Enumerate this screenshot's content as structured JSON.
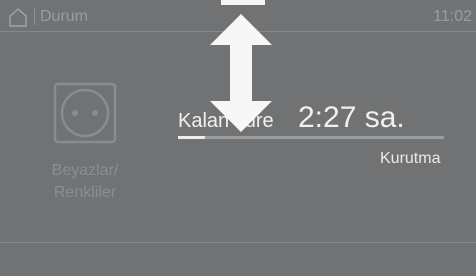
{
  "status_bar": {
    "title": "Durum",
    "time": "11:02"
  },
  "program": {
    "label": "Beyazlar/\nRenkliler",
    "icon": "socket-icon"
  },
  "remaining": {
    "label": "Kalan süre",
    "value": "2:27 sa.",
    "progress_fraction": 0.1
  },
  "phase": "Kurutma",
  "overlay": {
    "icon": "up-down-arrow-icon",
    "handle_icon": "drag-handle-icon"
  },
  "colors": {
    "background": "#707274",
    "text_primary": "#f0f0f0",
    "text_muted": "#8c8e90"
  }
}
